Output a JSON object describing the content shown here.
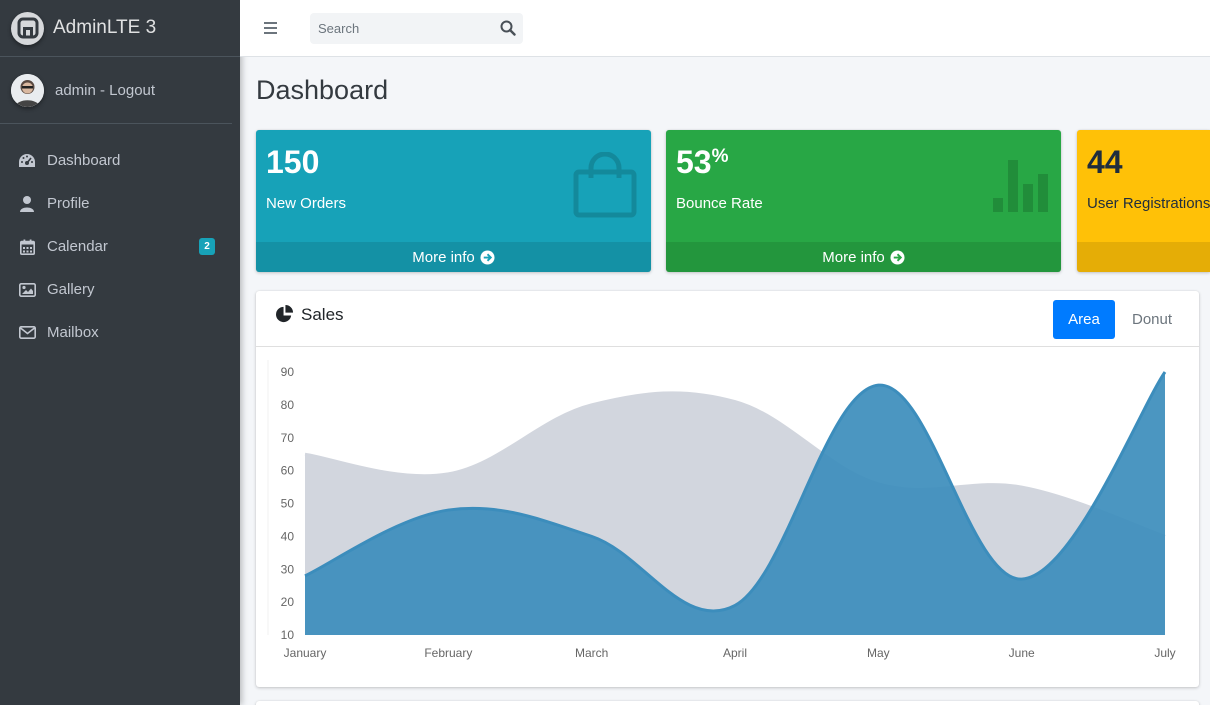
{
  "brand": {
    "name": "AdminLTE 3"
  },
  "user": {
    "link_text": "admin - Logout"
  },
  "sidebar": {
    "items": [
      {
        "label": "Dashboard",
        "icon": "tachometer-icon"
      },
      {
        "label": "Profile",
        "icon": "user-icon"
      },
      {
        "label": "Calendar",
        "icon": "calendar-icon",
        "badge": "2"
      },
      {
        "label": "Gallery",
        "icon": "image-icon"
      },
      {
        "label": "Mailbox",
        "icon": "envelope-icon"
      }
    ]
  },
  "navbar": {
    "search_placeholder": "Search"
  },
  "page": {
    "title": "Dashboard"
  },
  "stats": [
    {
      "value": "150",
      "suffix": "",
      "label": "New Orders",
      "footer": "More info",
      "color": "#17a2b8",
      "icon": "shopping-bag-icon"
    },
    {
      "value": "53",
      "suffix": "%",
      "label": "Bounce Rate",
      "footer": "More info",
      "color": "#28a745",
      "icon": "bar-chart-icon"
    },
    {
      "value": "44",
      "suffix": "",
      "label": "User Registrations",
      "footer": "",
      "color": "#ffc107",
      "icon": "user-plus-icon"
    }
  ],
  "sales": {
    "title": "Sales",
    "tabs": [
      "Area",
      "Donut"
    ],
    "active_tab": "Area"
  },
  "chart_data": {
    "type": "area",
    "categories": [
      "January",
      "February",
      "March",
      "April",
      "May",
      "June",
      "July"
    ],
    "series": [
      {
        "color": "#d2d6de",
        "values": [
          65,
          59,
          80,
          81,
          56,
          55,
          40
        ]
      },
      {
        "color": "#3c8dbc",
        "values": [
          28,
          48,
          40,
          19,
          86,
          27,
          90
        ]
      }
    ],
    "y_ticks": [
      90,
      80,
      70,
      60,
      50,
      40,
      30,
      20,
      10
    ],
    "ylim": [
      10,
      90
    ],
    "grid": false
  }
}
